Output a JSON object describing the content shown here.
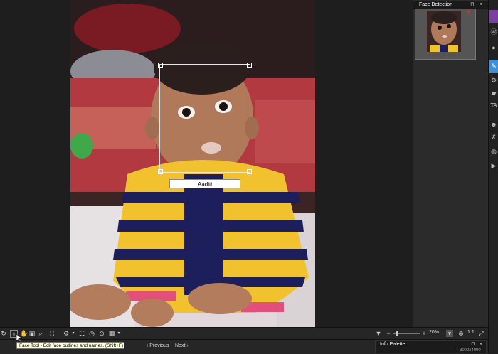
{
  "face_detection_panel": {
    "title": "Face Detection"
  },
  "face_tag": {
    "name_value": "Aaditi"
  },
  "toolbar": {
    "zoom_level": "20%",
    "ratio_label": "1:1"
  },
  "status": {
    "tooltip": "Face Tool - Edit face outlines and names. (Shift+F)",
    "previous_label": "Previous",
    "next_label": "Next",
    "info_palette_title": "Info Palette",
    "image_dimensions": "3000x4000",
    "info_dash": "--"
  },
  "colors": {
    "accent": "#3d8fd6",
    "brand_purple": "#7b3fa0",
    "close_red": "#e03030"
  },
  "icons": {
    "right_bar": [
      "wordpress-icon",
      "flickr-icon",
      "pin-icon",
      "network-icon",
      "comment-icon",
      "text-icon",
      "person-icon",
      "wrench-icon",
      "globe-icon",
      "play-icon"
    ]
  }
}
